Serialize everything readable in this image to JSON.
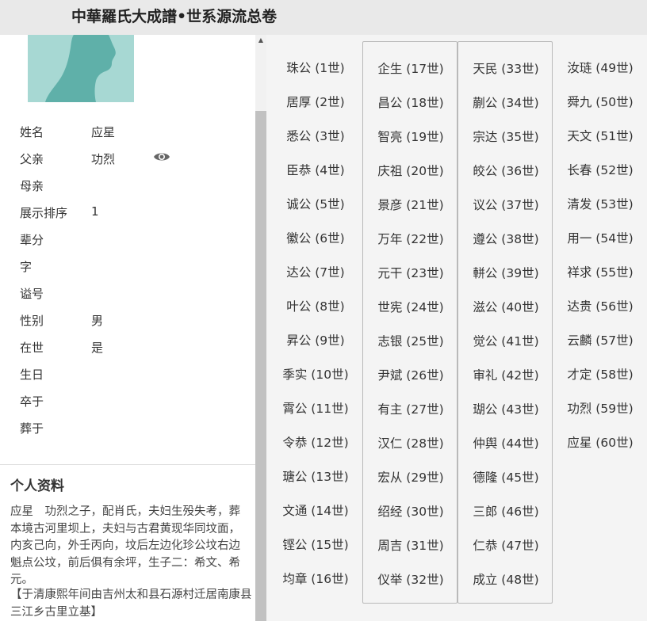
{
  "header": {
    "title": "中華羅氏大成譜•世系源流总卷"
  },
  "profile": {
    "fields": [
      {
        "label": "姓名",
        "value": "应星"
      },
      {
        "label": "父亲",
        "value": "功烈"
      },
      {
        "label": "母亲",
        "value": ""
      },
      {
        "label": "展示排序",
        "value": "1"
      },
      {
        "label": "辈分",
        "value": ""
      },
      {
        "label": "字",
        "value": ""
      },
      {
        "label": "谥号",
        "value": ""
      },
      {
        "label": "性别",
        "value": "男"
      },
      {
        "label": "在世",
        "value": "是"
      },
      {
        "label": "生日",
        "value": ""
      },
      {
        "label": "卒于",
        "value": ""
      },
      {
        "label": "葬于",
        "value": ""
      }
    ],
    "bio_title": "个人资料",
    "bio_text": "应星　功烈之子，配肖氏，夫妇生殁失考，葬本境古河里坝上，夫妇与古君黄现华同坟面，内亥己向，外壬丙向，坟后左边化珍公坟右边魁点公坟，前后俱有余坪，生子二：希文、希元。",
    "bio_note": "【于清康熙年间由吉州太和县石源村迁居南康县三江乡古里立基】"
  },
  "generations": [
    [
      "珠公 (1世)",
      "居厚 (2世)",
      "悉公 (3世)",
      "臣恭 (4世)",
      "诚公 (5世)",
      "徽公 (6世)",
      "达公 (7世)",
      "叶公 (8世)",
      "昇公 (9世)",
      "季实 (10世)",
      "霄公 (11世)",
      "令恭 (12世)",
      "瑭公 (13世)",
      "文通 (14世)",
      "铿公 (15世)",
      "均章 (16世)"
    ],
    [
      "企生 (17世)",
      "昌公 (18世)",
      "智亮 (19世)",
      "庆祖 (20世)",
      "景彦 (21世)",
      "万年 (22世)",
      "元干 (23世)",
      "世宪 (24世)",
      "志银 (25世)",
      "尹斌 (26世)",
      "有主 (27世)",
      "汉仁 (28世)",
      "宏从 (29世)",
      "绍经 (30世)",
      "周吉 (31世)",
      "仪举 (32世)"
    ],
    [
      "天民 (33世)",
      "蒯公 (34世)",
      "宗达 (35世)",
      "皎公 (36世)",
      "议公 (37世)",
      "遵公 (38世)",
      "軿公 (39世)",
      "滋公 (40世)",
      "觉公 (41世)",
      "审礼 (42世)",
      "瑚公 (43世)",
      "仲舆 (44世)",
      "德隆 (45世)",
      "三郎 (46世)",
      "仁恭 (47世)",
      "成立 (48世)"
    ],
    [
      "汝琏 (49世)",
      "舜九 (50世)",
      "天文 (51世)",
      "长春 (52世)",
      "清发 (53世)",
      "用一 (54世)",
      "祥求 (55世)",
      "达贵 (56世)",
      "云麟 (57世)",
      "才定 (58世)",
      "功烈 (59世)",
      "应星 (60世)"
    ]
  ],
  "icons": {
    "eye": "eye-icon",
    "scroll_up": "arrow-up-icon"
  },
  "colors": {
    "avatar_bg": "#a7d8d3",
    "avatar_silhouette": "#5fb0a9",
    "header_bg": "#e9e9e9",
    "panel_bg": "#f4f4f4"
  }
}
